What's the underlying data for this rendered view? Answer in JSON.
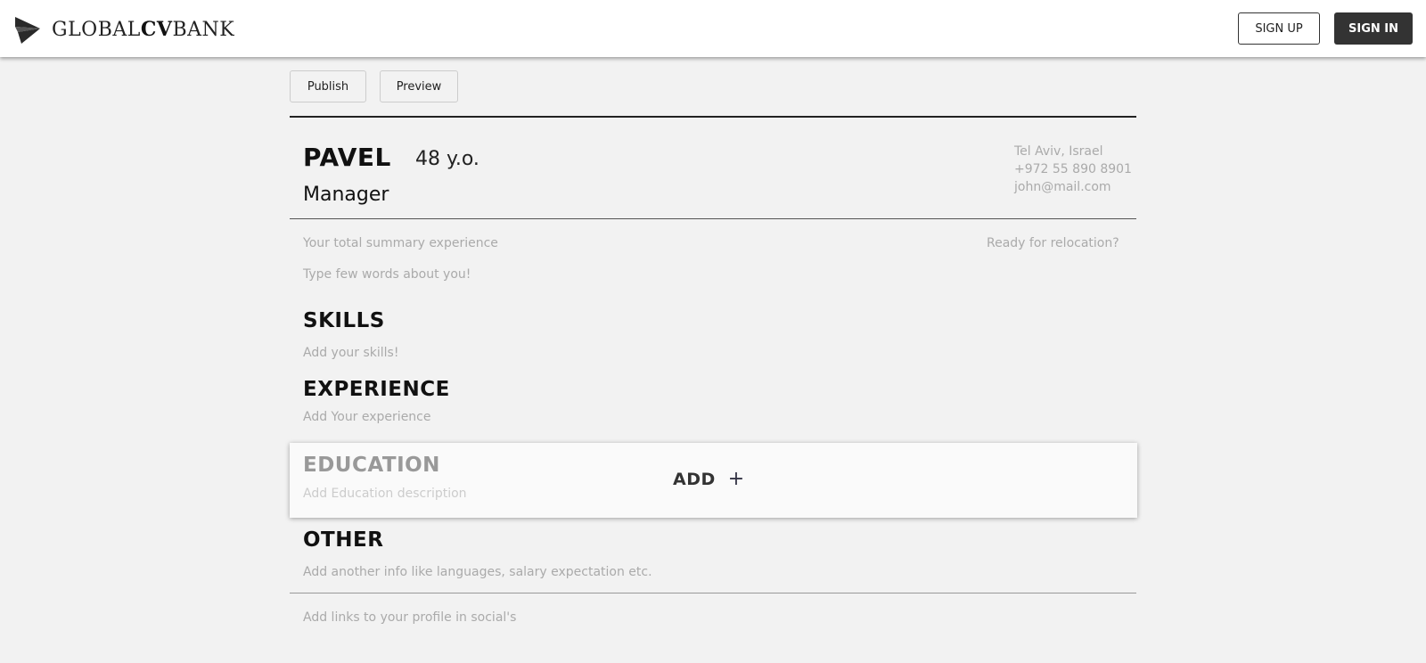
{
  "header": {
    "logo": {
      "part1": "GLOBAL",
      "part2": "CV",
      "part3": "BANK",
      "icon": "paper-plane-icon"
    },
    "signup_label": "SIGN UP",
    "signin_label": "SIGN IN"
  },
  "toolbar": {
    "publish_label": "Publish",
    "preview_label": "Preview"
  },
  "profile": {
    "name": "PAVEL",
    "age": "48 y.o.",
    "position": "Manager",
    "contact": {
      "location": "Tel Aviv, Israel",
      "phone": "+972 55 890 8901",
      "email": "john@mail.com"
    },
    "summary_placeholder": "Your total summary experience",
    "relocation_placeholder": "Ready for relocation?",
    "about_placeholder": "Type few words about you!"
  },
  "sections": {
    "skills": {
      "title": "SKILLS",
      "placeholder": "Add your skills!"
    },
    "experience": {
      "title": "EXPERIENCE",
      "placeholder": "Add Your experience"
    },
    "education": {
      "title": "EDUCATION",
      "placeholder": "Add Education description",
      "add_label": "ADD",
      "add_icon": "+"
    },
    "other": {
      "title": "OTHER",
      "placeholder": "Add another info like languages, salary expectation etc."
    }
  },
  "social_placeholder": "Add links to your profile in social's",
  "colors": {
    "header_bg": "#ffffff",
    "page_bg": "#f2f2f2",
    "signin_bg": "#333333",
    "muted_text": "#aaaaaa"
  }
}
